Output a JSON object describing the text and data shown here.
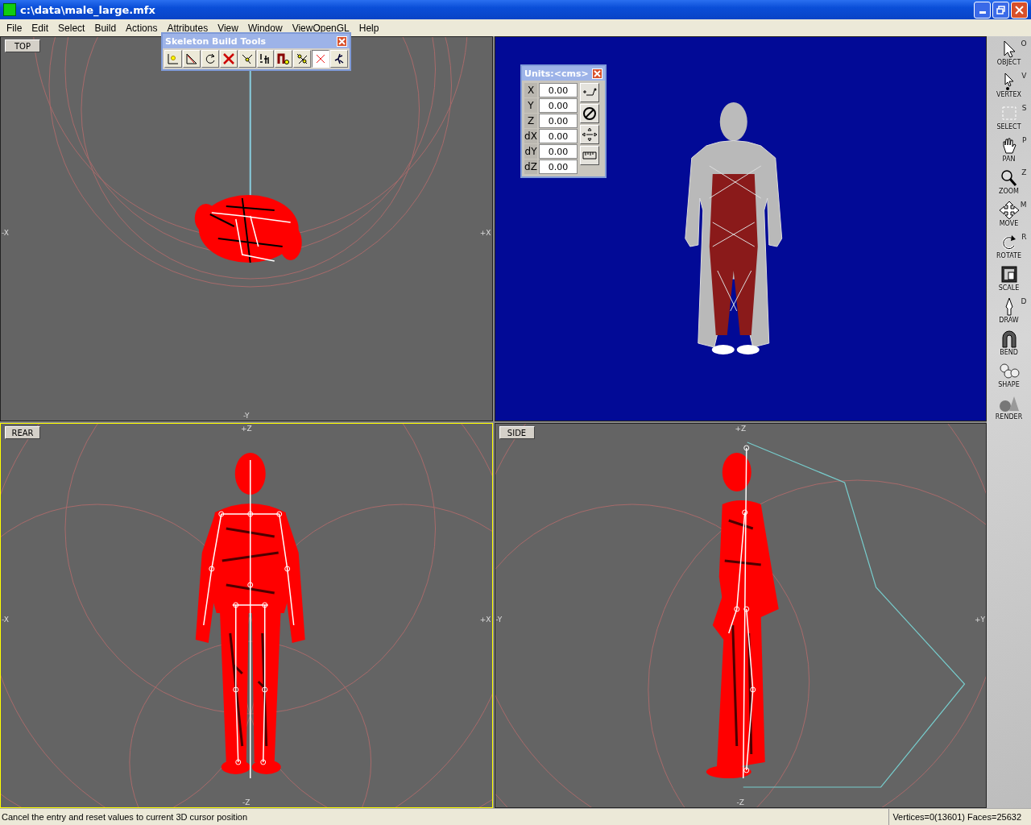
{
  "window": {
    "title": "c:\\data\\male_large.mfx"
  },
  "menu": [
    "File",
    "Edit",
    "Select",
    "Build",
    "Actions",
    "Attributes",
    "View",
    "Window",
    "ViewOpenGL",
    "Help"
  ],
  "viewports": [
    {
      "kind": "top",
      "label": "TOP",
      "selected": false,
      "axis_left": "-X",
      "axis_right": "+X",
      "axis_bottom": "-Y"
    },
    {
      "kind": "perspective",
      "selected": false
    },
    {
      "kind": "rear",
      "label": "REAR",
      "selected": true,
      "axis_top": "+Z",
      "axis_left": "-X",
      "axis_right": "+X",
      "axis_bottom": "-Z"
    },
    {
      "kind": "side",
      "label": "SIDE",
      "selected": false,
      "axis_top": "+Z",
      "axis_left": "-Y",
      "axis_right": "+Y",
      "axis_bottom": "-Z"
    }
  ],
  "skeleton_tools": {
    "title": "Skeleton Build Tools",
    "buttons": [
      {
        "selected": false
      },
      {
        "selected": false
      },
      {
        "selected": false
      },
      {
        "selected": false
      },
      {
        "selected": false
      },
      {
        "selected": false
      },
      {
        "selected": false
      },
      {
        "selected": false
      },
      {
        "selected": true
      },
      {
        "selected": false
      }
    ]
  },
  "units_panel": {
    "title": "Units:<cms>",
    "fields": [
      {
        "label": "X",
        "value": "0.00"
      },
      {
        "label": "Y",
        "value": "0.00"
      },
      {
        "label": "Z",
        "value": "0.00"
      },
      {
        "label": "dX",
        "value": "0.00"
      },
      {
        "label": "dY",
        "value": "0.00"
      },
      {
        "label": "dZ",
        "value": "0.00"
      }
    ]
  },
  "tools": [
    {
      "label": "OBJECT",
      "key": "O"
    },
    {
      "label": "VERTEX",
      "key": "V"
    },
    {
      "label": "SELECT",
      "key": "S"
    },
    {
      "label": "PAN",
      "key": "P"
    },
    {
      "label": "ZOOM",
      "key": "Z"
    },
    {
      "label": "MOVE",
      "key": "M"
    },
    {
      "label": "ROTATE",
      "key": "R"
    },
    {
      "label": "SCALE"
    },
    {
      "label": "DRAW",
      "key": "D"
    },
    {
      "label": "BEND"
    },
    {
      "label": "SHAPE"
    },
    {
      "label": "RENDER"
    }
  ],
  "status_bar": {
    "message": "Cancel the entry and reset values to current 3D cursor position",
    "counts": "Vertices=0(13601) Faces=25632"
  }
}
